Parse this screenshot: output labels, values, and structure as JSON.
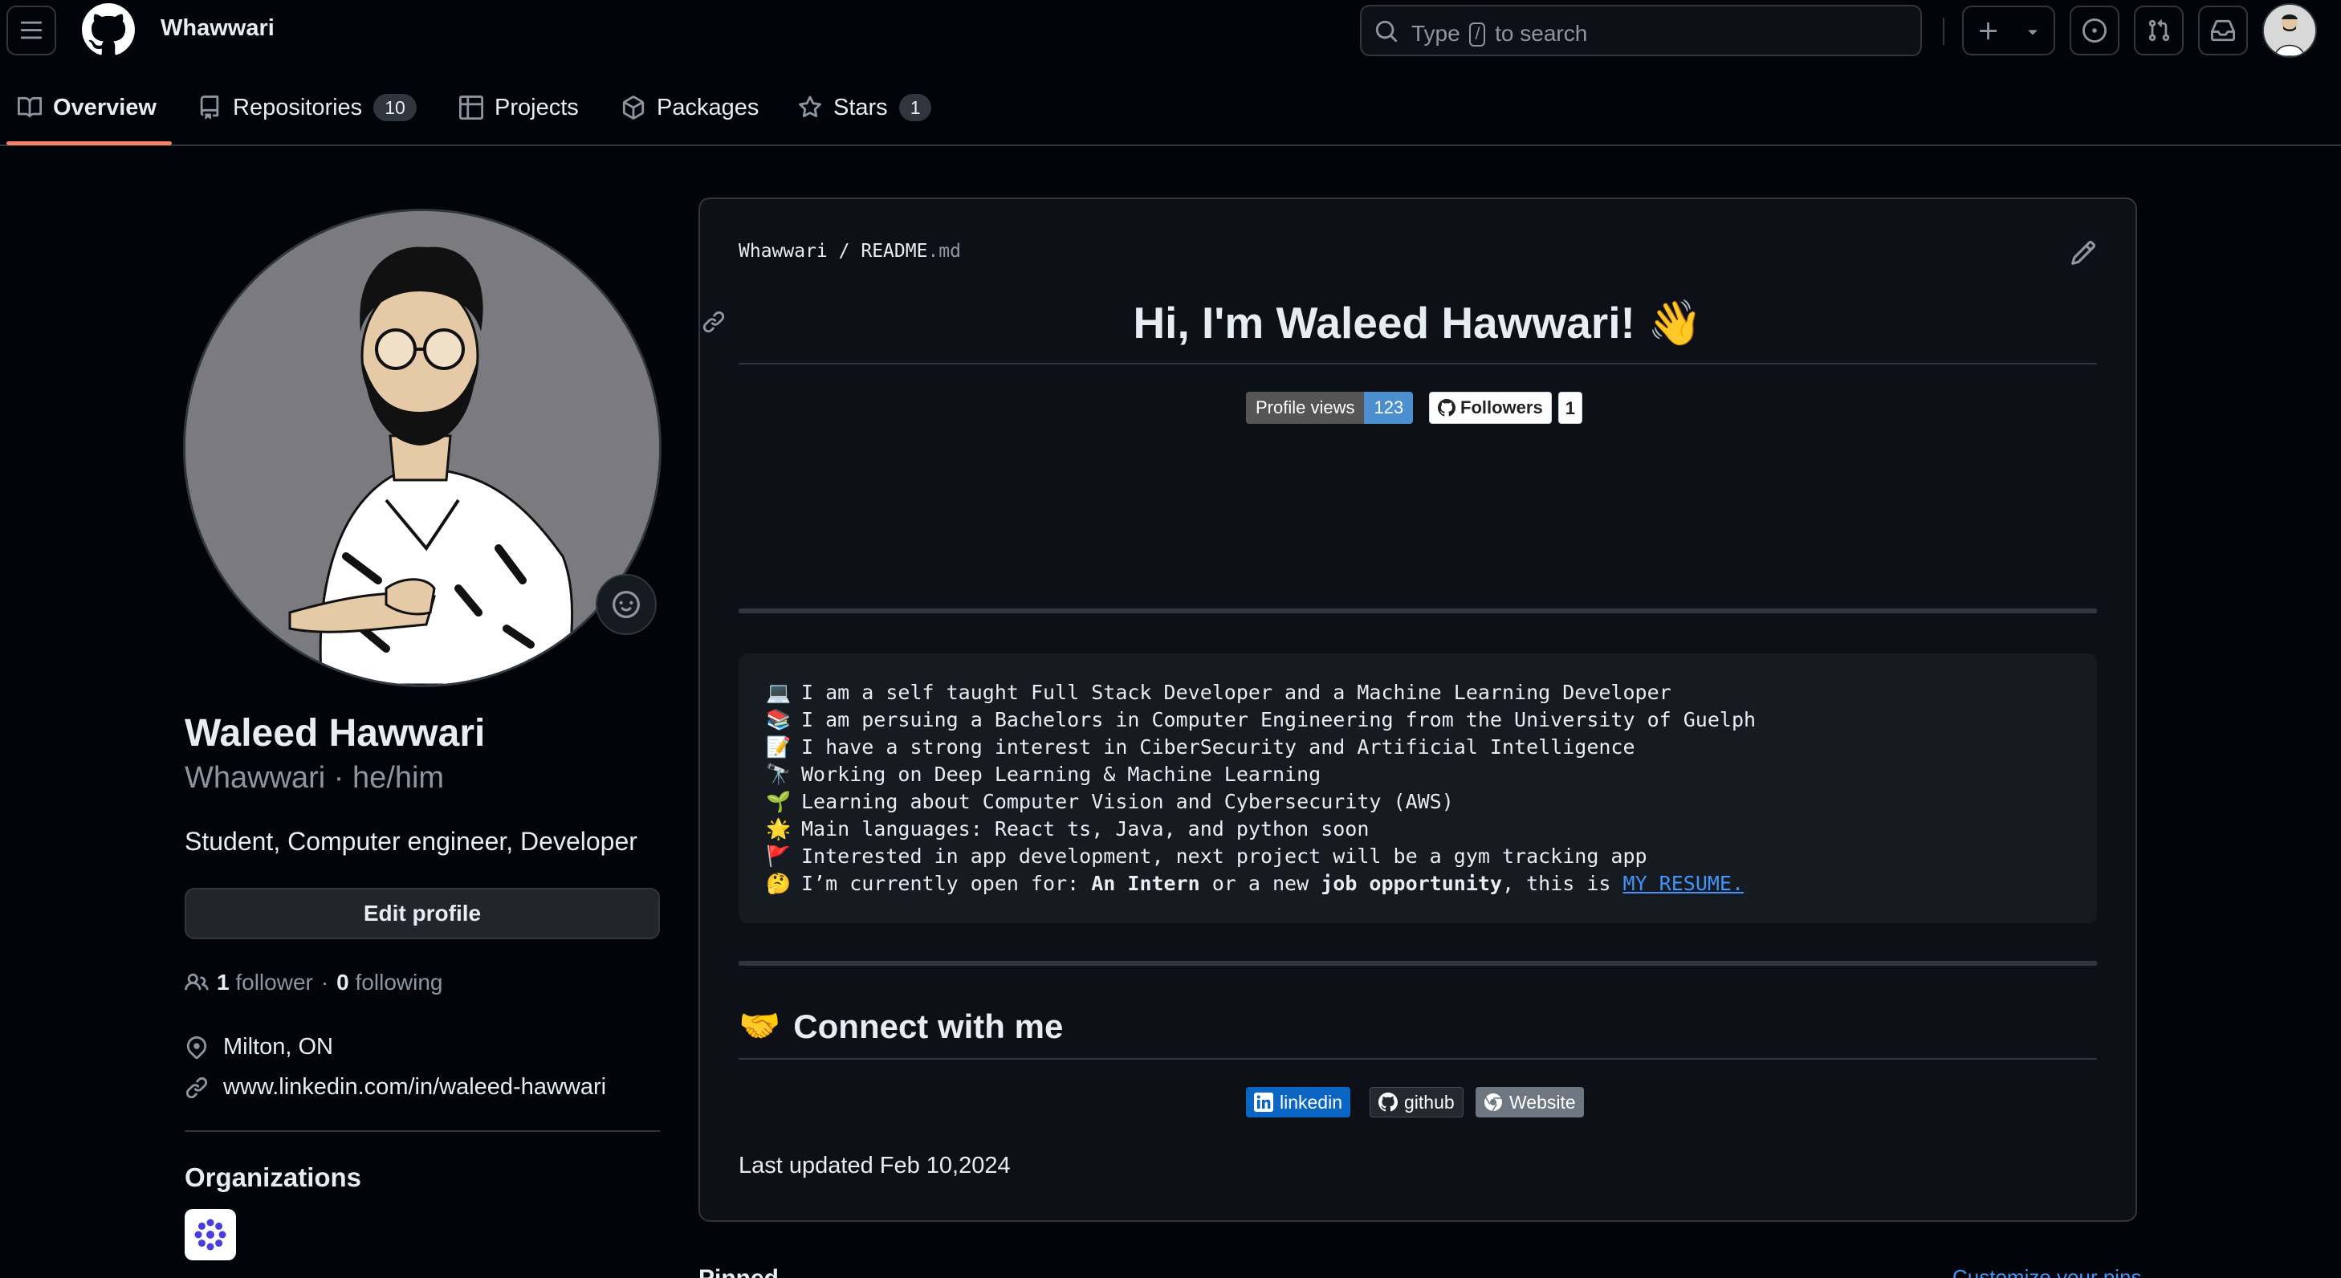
{
  "header": {
    "owner": "Whawwari",
    "search_prefix": "Type",
    "search_key": "/",
    "search_suffix": "to search"
  },
  "tabs": [
    {
      "label": "Overview"
    },
    {
      "label": "Repositories",
      "count": "10"
    },
    {
      "label": "Projects"
    },
    {
      "label": "Packages"
    },
    {
      "label": "Stars",
      "count": "1"
    }
  ],
  "profile": {
    "full_name": "Waleed Hawwari",
    "username_line": "Whawwari · he/him",
    "bio": "Student, Computer engineer, Developer",
    "edit_label": "Edit profile",
    "followers_count": "1",
    "followers_label": "follower",
    "following_count": "0",
    "following_label": "following",
    "location": "Milton, ON",
    "website": "www.linkedin.com/in/waleed-hawwari",
    "orgs_title": "Organizations"
  },
  "readme": {
    "path_owner": "Whawwari",
    "path_sep": "/",
    "path_file": "README",
    "path_ext": ".md",
    "heading": "Hi, I'm Waleed Hawwari! 👋",
    "views_label": "Profile views",
    "views_count": "123",
    "followers_label": "Followers",
    "followers_count": "1",
    "lines": [
      {
        "emoji": "💻",
        "text": "I am a self taught Full Stack Developer and a Machine Learning Developer"
      },
      {
        "emoji": "📚",
        "text": "I am persuing a Bachelors in Computer Engineering from the University of Guelph"
      },
      {
        "emoji": "📝",
        "text": "I have a strong interest in CiberSecurity and Artificial Intelligence"
      },
      {
        "emoji": "🔭",
        "text": "Working on Deep Learning & Machine Learning"
      },
      {
        "emoji": "🌱",
        "text": "Learning about Computer Vision and Cybersecurity (AWS)"
      },
      {
        "emoji": "🌟",
        "text": "Main languages: React ts, Java, and python soon"
      },
      {
        "emoji": "🚩",
        "text": "Interested in app development, next project will be a gym tracking app"
      }
    ],
    "last_line": {
      "emoji": "🤔",
      "prefix": "I’m currently open for: ",
      "bold1": "An Intern",
      "mid": " or a new ",
      "bold2": "job opportunity",
      "suffix": ", this is ",
      "link": "MY RESUME."
    },
    "connect_emoji": "🤝",
    "connect_heading": "Connect with me",
    "badge_linkedin": "linkedin",
    "badge_github": "github",
    "badge_website": "Website",
    "last_updated": "Last updated Feb 10,2024"
  },
  "pinned": {
    "title": "Pinned",
    "customize": "Customize your pins"
  },
  "colors": {
    "bg": "#010409",
    "accent_underline": "#f78166",
    "link": "#4493f8",
    "border": "#30363d"
  },
  "icons": [
    "menu-icon",
    "github-logo-icon",
    "search-icon",
    "plus-icon",
    "chevron-down-icon",
    "issue-icon",
    "pull-request-icon",
    "inbox-icon",
    "book-icon",
    "repo-icon",
    "table-icon",
    "package-icon",
    "star-icon",
    "smiley-icon",
    "people-icon",
    "location-icon",
    "link-icon",
    "pencil-icon"
  ]
}
